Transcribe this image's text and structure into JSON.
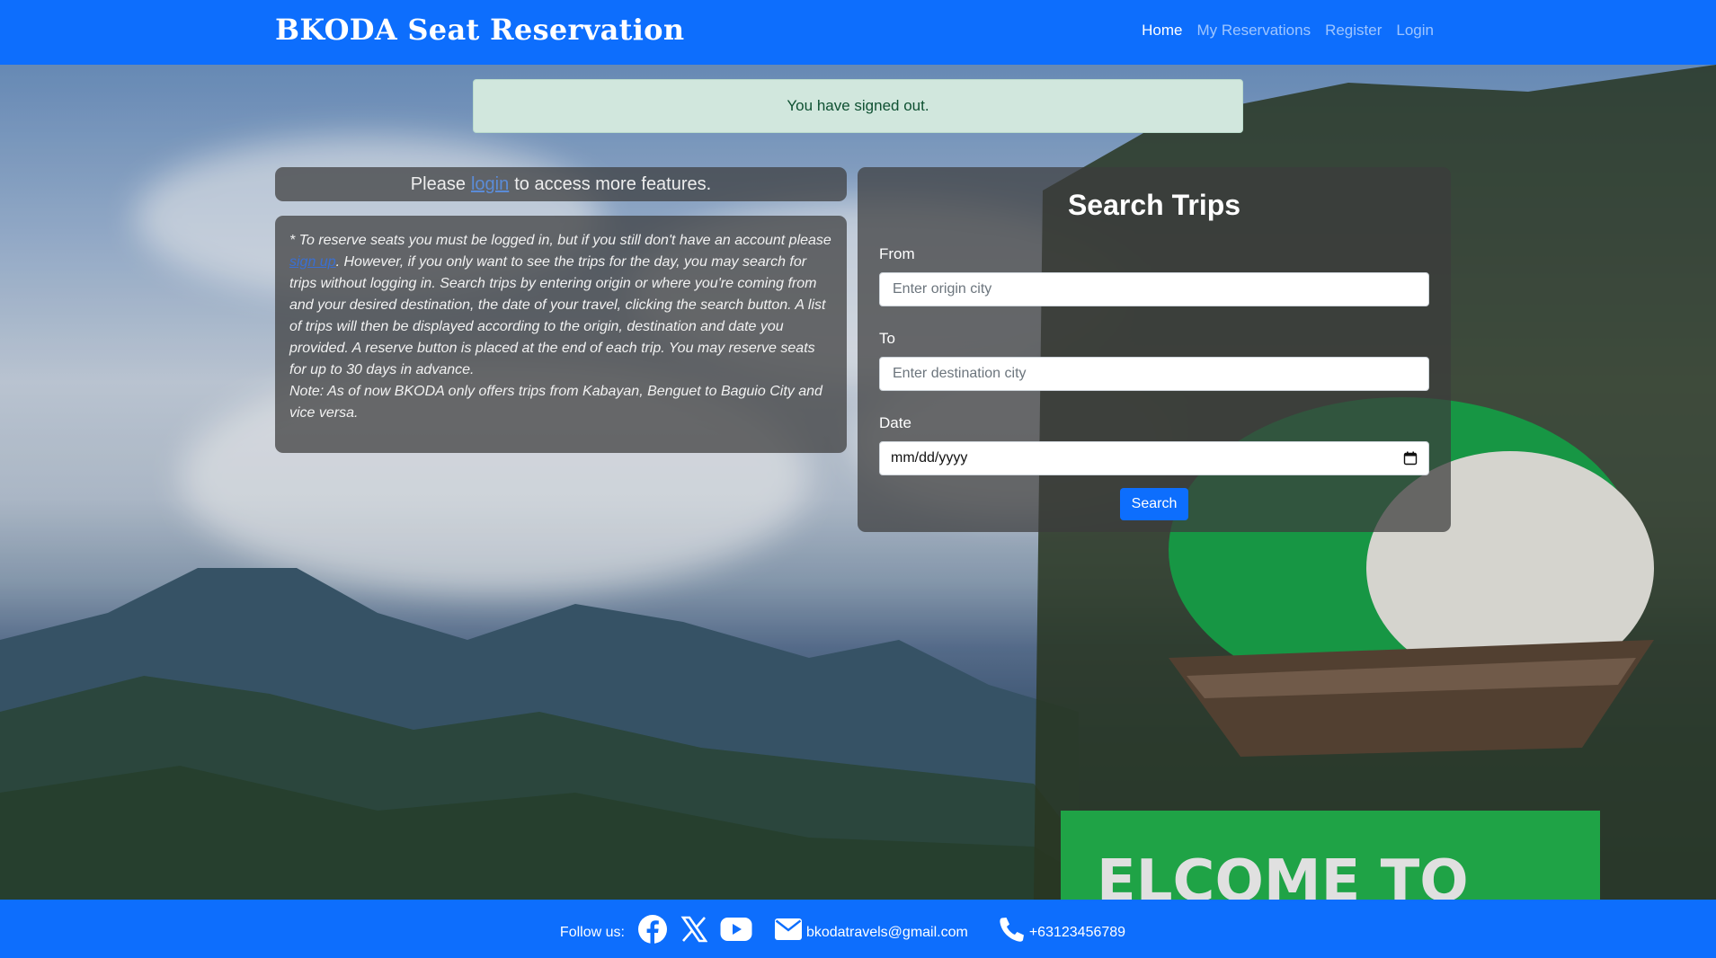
{
  "navbar": {
    "brand": "BKODA Seat Reservation",
    "links": [
      "Home",
      "My Reservations",
      "Register",
      "Login"
    ]
  },
  "alert": {
    "message": "You have signed out."
  },
  "login_prompt": {
    "before": "Please",
    "link": "login",
    "after": "to access more features."
  },
  "info": {
    "p1_before": "* To reserve seats you must be logged in, but if you still don't have an account please",
    "p1_link": "sign up",
    "p1_after": ". However, if you only want to see the trips for the day, you may search for trips without logging in. Search trips by entering origin or where you're coming from and your desired destination, the date of your travel, clicking the search button. A list of trips will then be displayed according to the origin, destination and date you provided. A reserve button is placed at the end of each trip. You may reserve seats for up to 30 days in advance.",
    "note": "Note: As of now BKODA only offers trips from Kabayan, Benguet to Baguio City and vice versa."
  },
  "search": {
    "title": "Search Trips",
    "from_label": "From",
    "from_placeholder": "Enter origin city",
    "to_label": "To",
    "to_placeholder": "Enter destination city",
    "date_label": "Date",
    "date_value": "mm/dd/yyyy",
    "button": "Search"
  },
  "footer": {
    "follow": "Follow us:",
    "icons": [
      "facebook-icon",
      "x-icon",
      "youtube-icon",
      "envelope-icon",
      "phone-icon"
    ],
    "email": "bkodatravels@gmail.com",
    "phone": "+63123456789"
  },
  "colors": {
    "primary": "#0d6efd",
    "alert_bg": "#d1e7dd",
    "alert_text": "#0f5132"
  }
}
